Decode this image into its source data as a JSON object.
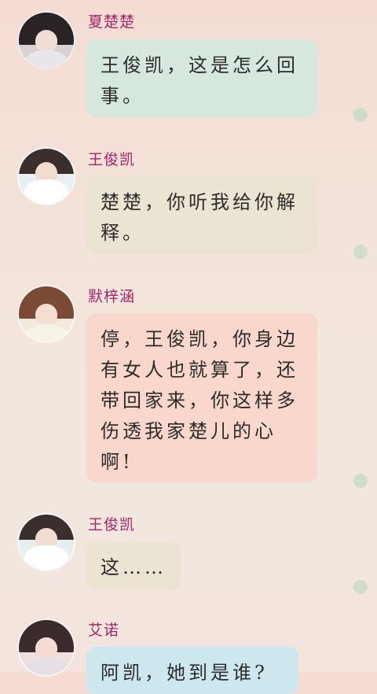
{
  "messages": [
    {
      "name": "夏楚楚",
      "text": "王俊凯，这是怎么回事。",
      "bubble_color": "#d5e7dc"
    },
    {
      "name": "王俊凯",
      "text": "楚楚，你听我给你解释。",
      "bubble_color": "#eae3d2"
    },
    {
      "name": "默梓涵",
      "text": "停，王俊凯，你身边有女人也就算了，还带回家来，你这样多伤透我家楚儿的心啊!",
      "bubble_color": "#f8d6cd"
    },
    {
      "name": "王俊凯",
      "text": "这……",
      "bubble_color": "#ebe4d3"
    },
    {
      "name": "艾诺",
      "text": "阿凯，她到是谁?",
      "bubble_color": "#cde7ee"
    }
  ]
}
